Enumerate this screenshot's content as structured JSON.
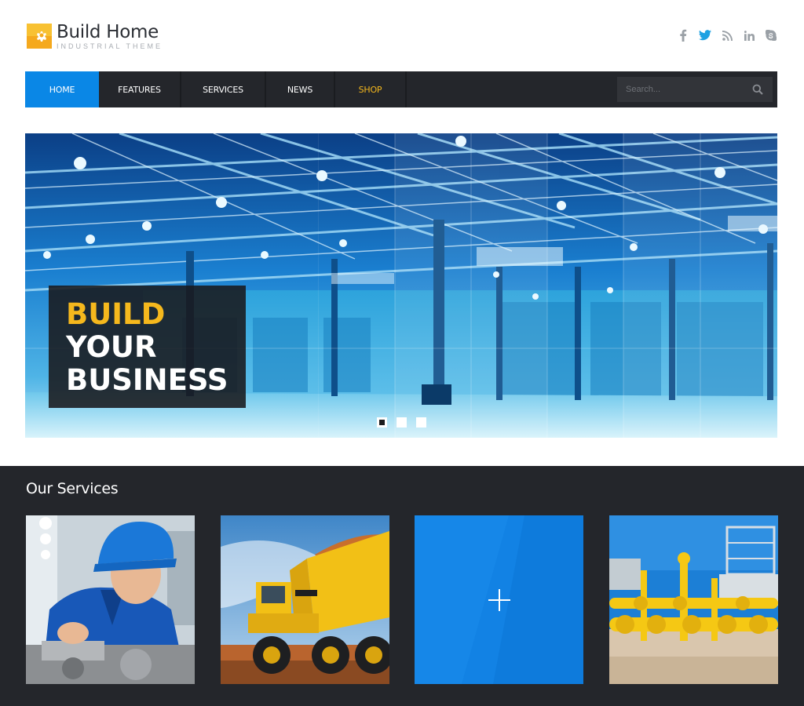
{
  "brand": {
    "title": "Build Home",
    "subtitle": "INDUSTRIAL THEME",
    "accent": "#f5a91d"
  },
  "social": [
    "facebook-icon",
    "twitter-icon",
    "rss-icon",
    "linkedin-icon",
    "skype-icon"
  ],
  "nav": {
    "items": [
      {
        "label": "HOME",
        "active": true
      },
      {
        "label": "FEATURES"
      },
      {
        "label": "SERVICES"
      },
      {
        "label": "NEWS"
      },
      {
        "label": "SHOP",
        "highlight": true
      }
    ],
    "search_placeholder": "Search..."
  },
  "hero": {
    "line1": "BUILD",
    "line2": "YOUR",
    "line3": "BUSINESS",
    "slides": 3,
    "active_slide": 1
  },
  "services": {
    "title": "Our Services"
  },
  "colors": {
    "nav_bg": "#24262b",
    "active": "#0a87e6",
    "highlight": "#f5b81d",
    "dark_section": "#24262b"
  }
}
